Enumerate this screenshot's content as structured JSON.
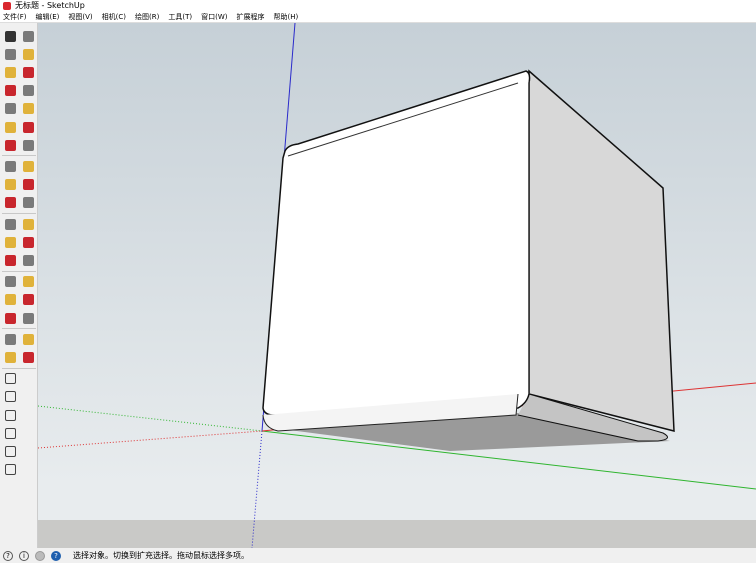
{
  "window": {
    "title": "无标题 - SketchUp"
  },
  "menu": [
    "文件(F)",
    "编辑(E)",
    "视图(V)",
    "相机(C)",
    "绘图(R)",
    "工具(T)",
    "窗口(W)",
    "扩展程序",
    "帮助(H)"
  ],
  "toolbar": [
    [
      "select",
      "eraser-paint"
    ],
    [
      "paint-bucket",
      "eraser"
    ],
    [
      "line",
      "freehand"
    ],
    [
      "rectangle",
      "rotated-rectangle"
    ],
    [
      "circle",
      "polygon"
    ],
    [
      "arc",
      "two-point-arc"
    ],
    [
      "three-point-arc",
      "pie"
    ],
    [
      "move",
      "push-pull"
    ],
    [
      "rotate",
      "follow-me"
    ],
    [
      "scale",
      "offset"
    ],
    [
      "tape-measure",
      "dimension"
    ],
    [
      "protractor",
      "text"
    ],
    [
      "axes",
      "3d-text"
    ],
    [
      "orbit",
      "pan"
    ],
    [
      "zoom",
      "zoom-window"
    ],
    [
      "zoom-extents",
      "previous-view"
    ],
    [
      "position-camera",
      "look-around"
    ],
    [
      "walk",
      "section-plane"
    ],
    [
      "iso-view"
    ],
    [
      "top-view"
    ],
    [
      "front-view"
    ],
    [
      "right-view"
    ],
    [
      "back-view"
    ],
    [
      "left-view"
    ]
  ],
  "toolbar_colors": {
    "red": "#c8262d",
    "yellow": "#e0b23a",
    "gray": "#7a7a7a"
  },
  "status": {
    "text": "选择对象。切换到扩充选择。拖动鼠标选择多项。",
    "icons": [
      "geo-location-icon",
      "credits-icon",
      "user-icon",
      "help-icon"
    ]
  }
}
